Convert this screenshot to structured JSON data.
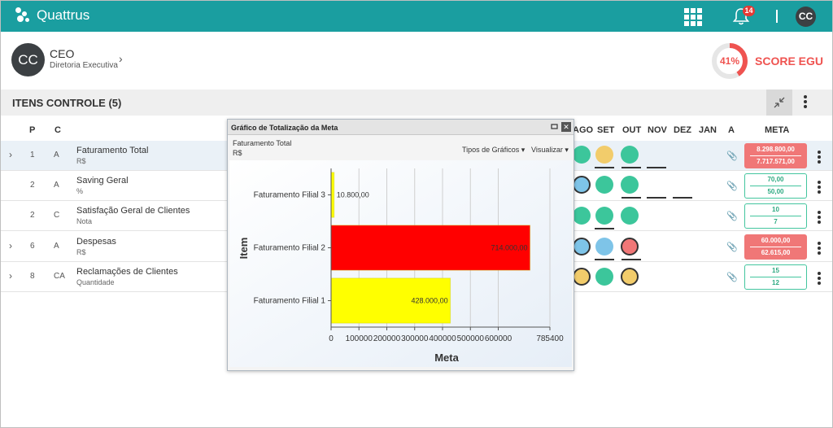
{
  "header": {
    "app_name": "Quattrus",
    "notification_count": "14",
    "user_initials": "CC"
  },
  "profile": {
    "initials": "CC",
    "role": "CEO",
    "department": "Diretoria Executiva",
    "score_value": "41%",
    "score_fraction": 0.41,
    "score_label": "SCORE EGU"
  },
  "section": {
    "title": "ITENS CONTROLE (5)"
  },
  "columns": {
    "p": "P",
    "c": "C",
    "months": [
      "AGO",
      "SET",
      "OUT",
      "NOV",
      "DEZ",
      "JAN"
    ],
    "a": "A",
    "meta": "META"
  },
  "rows": [
    {
      "p": "1",
      "c": "A",
      "name": "Faturamento Total",
      "unit": "R$",
      "meta_top": "8.298.800,00",
      "meta_bottom": "7.717.571,00",
      "status": [
        "green",
        "yellow",
        "green"
      ],
      "meta_alert": true
    },
    {
      "p": "2",
      "c": "A",
      "name": "Saving Geral",
      "unit": "%",
      "meta_top": "70,00",
      "meta_bottom": "50,00",
      "status": [
        "blue",
        "green",
        "green"
      ],
      "meta_alert": false
    },
    {
      "p": "2",
      "c": "C",
      "name": "Satisfação Geral de Clientes",
      "unit": "Nota",
      "meta_top": "10",
      "meta_bottom": "7",
      "status": [
        "green",
        "green",
        "green"
      ],
      "meta_alert": false
    },
    {
      "p": "6",
      "c": "A",
      "name": "Despesas",
      "unit": "R$",
      "meta_top": "60.000,00",
      "meta_bottom": "62.615,00",
      "status": [
        "blue",
        "blue",
        "red"
      ],
      "meta_alert": true
    },
    {
      "p": "8",
      "c": "CA",
      "name": "Reclamações de Clientes",
      "unit": "Quantidade",
      "meta_top": "15",
      "meta_bottom": "12",
      "status": [
        "yellow",
        "green",
        "yellow"
      ],
      "meta_alert": false
    }
  ],
  "status_colors": {
    "green": "#3cc69b",
    "yellow": "#f2cc6b",
    "blue": "#7ec4e8",
    "red": "#f07777"
  },
  "dialog": {
    "title": "Gráfico de Totalização da Meta",
    "subtitle_item": "Faturamento Total",
    "subtitle_unit": "R$",
    "menu_chart_types": "Tipos de Gráficos",
    "menu_view": "Visualizar"
  },
  "chart_data": {
    "type": "bar",
    "orientation": "horizontal",
    "categories": [
      "Faturamento Filial 3",
      "Faturamento Filial 2",
      "Faturamento Filial 1"
    ],
    "values": [
      10800,
      714000,
      428000
    ],
    "value_labels": [
      "10.800,00",
      "714.000,00",
      "428.000,00"
    ],
    "bar_colors": [
      "#ffff00",
      "#ff0000",
      "#ffff00"
    ],
    "xlabel": "Meta",
    "ylabel": "Item",
    "xlim": [
      0,
      785400
    ],
    "xticks": [
      0,
      100000,
      200000,
      300000,
      400000,
      500000,
      600000,
      785400
    ],
    "grid": true,
    "legend": false
  }
}
